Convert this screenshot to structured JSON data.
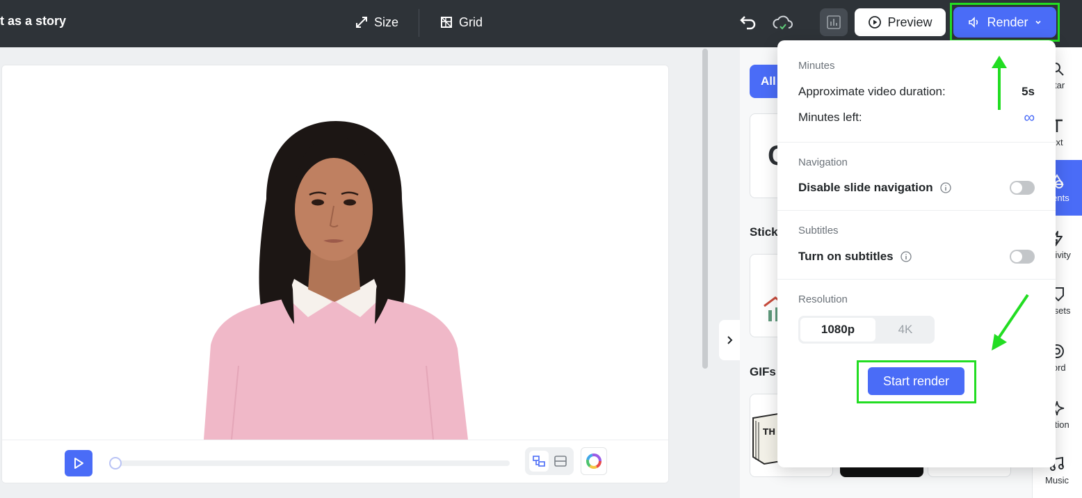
{
  "topbar": {
    "project_title": "t as a story",
    "size_label": "Size",
    "grid_label": "Grid",
    "preview_label": "Preview",
    "render_label": "Render"
  },
  "render_menu": {
    "minutes": {
      "title": "Minutes",
      "duration_label": "Approximate video duration:",
      "duration_value": "5s",
      "minutes_left_label": "Minutes left:",
      "minutes_left_value": "∞"
    },
    "navigation": {
      "title": "Navigation",
      "disable_label": "Disable slide navigation",
      "disable_on": false
    },
    "subtitles": {
      "title": "Subtitles",
      "turn_on_label": "Turn on subtitles",
      "turn_on_on": false
    },
    "resolution": {
      "title": "Resolution",
      "options": [
        "1080p",
        "4K"
      ],
      "selected": "1080p"
    },
    "start_render_label": "Start render"
  },
  "elements_panel": {
    "filter_all": "All",
    "card_1_glyph": "C",
    "stickers_heading": "Stick",
    "gifs_heading": "GIFs"
  },
  "sidebar": {
    "items": [
      {
        "label": "atar",
        "icon": "search-icon"
      },
      {
        "label": "ext",
        "icon": "text-icon"
      },
      {
        "label": "ments",
        "icon": "shapes-icon"
      },
      {
        "label": "activity",
        "icon": "lightning-icon"
      },
      {
        "label": "Assets",
        "icon": "tag-icon"
      },
      {
        "label": "cord",
        "icon": "record-icon"
      },
      {
        "label": "nation",
        "icon": "sparkle-icon"
      },
      {
        "label": "Music",
        "icon": "music-icon"
      }
    ]
  },
  "player": {
    "progress": 0
  },
  "colors": {
    "accent": "#4a6cf7",
    "topbar": "#2e3338",
    "highlight": "#22dd22"
  }
}
